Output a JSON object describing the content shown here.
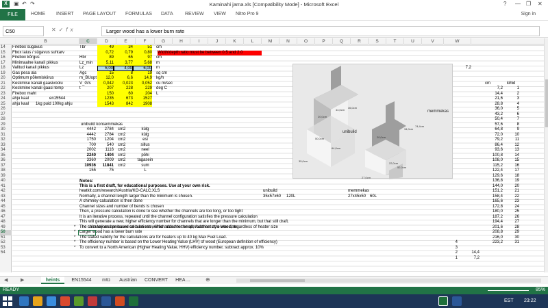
{
  "window": {
    "title": "Kaminahi jama.xls [Compatibility Mode] - Microsoft Excel",
    "help": "?",
    "minimize": "—",
    "restore": "❐",
    "close": "✕"
  },
  "ribbon": {
    "tabs": [
      "FILE",
      "HOME",
      "INSERT",
      "PAGE LAYOUT",
      "FORMULAS",
      "DATA",
      "REVIEW",
      "VIEW",
      "Nitro Pro 9"
    ],
    "sign_in": "Sign in"
  },
  "formula_bar": {
    "name_box": "C50",
    "fx": "fx",
    "content": "Larger wood has a lower burn rate"
  },
  "columns": [
    "B",
    "C",
    "D",
    "E",
    "F",
    "G",
    "H",
    "I",
    "J",
    "K",
    "L",
    "M",
    "N",
    "O",
    "P",
    "Q",
    "R",
    "S",
    "T",
    "U",
    "V",
    "W"
  ],
  "selected_column": "C",
  "rows": [
    "14",
    "15",
    "16",
    "17",
    "18",
    "19",
    "20",
    "21",
    "22",
    "23",
    "24",
    "25",
    "26",
    "27",
    "28",
    "29",
    "30",
    "31",
    "32",
    "33",
    "34",
    "35",
    "36",
    "37",
    "38",
    "39",
    "40",
    "41",
    "42",
    "43",
    "44",
    "45",
    "46",
    "47",
    "48",
    "49",
    "50",
    "51",
    "52",
    "53",
    "54"
  ],
  "selected_row": "50",
  "cells": {
    "a14": "Firebox sügavus",
    "b14": "Tbr",
    "c14": "49",
    "d14": "34",
    "e14": "51",
    "f14": "cm",
    "a15": "Fbox laius / sügavus suhtarv",
    "c15": "0,72",
    "d15": "0,79",
    "e15": "0,80",
    "warn15": "Width/depth ratio must be between 0.5 and 2.0",
    "a16": "Firebox kõrgus",
    "b16": "Hbr",
    "c16": "89",
    "d16": "65",
    "e16": "97",
    "f16": "cm",
    "a17": "Minimaalne kanali pikkus",
    "b17": "Lz_min",
    "c17": "5,11",
    "d17": "3,77",
    "e17": "5,68",
    "f17": "m",
    "a18": "Valitud kanali pikkus",
    "b18": "Lz",
    "c18": "6,00",
    "d18": "4,00",
    "e18": "6,00",
    "f18": "m",
    "a19": "Gas pesa ala",
    "b19": "Agc",
    "c19": "15",
    "d19": "8",
    "e19": "19",
    "f19": "sq cm",
    "a20": "Optimum põlemiskiirus",
    "b20": "m_BUopt",
    "c20": "12,0",
    "d20": "6,6",
    "e20": "14,9",
    "f20": "kg/h",
    "a21": "Keskmise kanali gaasivoolu",
    "b21": "V_G/s",
    "c21": "0,042",
    "d21": "0,023",
    "e21": "0,052",
    "f21": "cu m/sec",
    "a22": "Keskmine kanali gaasi temp",
    "b22": "t",
    "c22": "207",
    "d22": "228",
    "e22": "229",
    "f22": "deg C",
    "a23": "Firebox maht",
    "c23": "150",
    "d23": "60",
    "e23": "204",
    "f23": "L",
    "a24": "ahju kaal",
    "b24": "en15544",
    "c24": "1235",
    "d24": "673",
    "e24": "1527",
    "a25": "ahju kaal",
    "b25": "1kg puid 100kg ahju",
    "c25": "1543",
    "d25": "842",
    "e25": "1908",
    "t18": "7,2",
    "v21": "cm",
    "w21": "kihid",
    "b29": "unibuild konsemmekas",
    "tbl": [
      [
        "4442",
        "2784",
        "cm2",
        "külg"
      ],
      [
        "4442",
        "2784",
        "cm2",
        "külg"
      ],
      [
        "1750",
        "1204",
        "cm2",
        "esi"
      ],
      [
        "700",
        "540",
        "cm2",
        "sillus"
      ],
      [
        "2002",
        "1116",
        "cm2",
        "neel"
      ],
      [
        "2240",
        "1404",
        "cm2",
        "põhi"
      ],
      [
        "3360",
        "2009",
        "cm2",
        "tagasein"
      ],
      [
        "10936",
        "11841",
        "cm2",
        "sum"
      ],
      [
        "155",
        "75",
        "",
        "L"
      ]
    ],
    "notes_title": "Notes:",
    "notes": [
      "This is a first draft, for educational purposes. Use at your own risk.",
      "heatkit.com/research/Austria/KO-CALC.XLS",
      "Normally, a channel length larger than the minimum is chosen.",
      "A chimney calculation is then done",
      "Channel sizes and number of bends is chosen",
      "Then, a pressure calculation is done to see whether the channels are too long, or too tight",
      "It is an iterative process, repeated until the channel configuration satisfies the pressure calculation",
      "This will generate a new, higher efficiency number  for channels that are longer than the minimum, but that still draft.",
      "The chimney and pressure calculations will be added to the spreadsheet at a later date"
    ],
    "unibuild_label": "unibuild",
    "unibuild_size": "35x57x60",
    "unibuild_vol": "120L",
    "memmekas_label": "memmekas",
    "memmekas_size": "27x45x50",
    "memmekas_vol": "60L",
    "bullets": [
      "The calculations are based on burn rate, which assumes small, Austrian style wood, regardless of heater size",
      "Larger wood has a lower burn rate",
      "The stated validity for the calculations are for heaters up to 40 kg Max Fuel Load.",
      "The efficiency number is based on the Lower Heating Value (LHV) of wood (European definition of efficiency)",
      "To convert to a North American (Higher Heating Value, HHV) efficiency number, subtract approx. 10%"
    ],
    "bullet_mark": "*",
    "t_col": [
      "4",
      "3",
      "2",
      "1"
    ],
    "u_col": [
      "14,4",
      "7,2"
    ]
  },
  "layers": {
    "cm": [
      "7,2",
      "14,4",
      "21,6",
      "28,8",
      "36,0",
      "43,2",
      "50,4",
      "57,6",
      "64,8",
      "72,0",
      "79,2",
      "86,4",
      "93,6",
      "100,8",
      "108,0",
      "115,2",
      "122,4",
      "129,6",
      "136,8",
      "144,0",
      "151,2",
      "158,4",
      "165,6",
      "172,8",
      "180,0",
      "187,2",
      "194,4",
      "201,6",
      "208,8",
      "216,0",
      "223,2"
    ],
    "n": [
      "1",
      "2",
      "3",
      "4",
      "5",
      "6",
      "7",
      "8",
      "9",
      "10",
      "11",
      "12",
      "13",
      "14",
      "15",
      "16",
      "17",
      "18",
      "19",
      "20",
      "21",
      "22",
      "23",
      "24",
      "25",
      "26",
      "27",
      "28",
      "29",
      "30",
      "31"
    ]
  },
  "chart": {
    "label_unibuild": "unibuild",
    "label_memmekas": "memmekas",
    "dims": [
      "44,0cm",
      "36,0cm",
      "20,0cm",
      "50,0cm",
      "64,0cm",
      "35,0cm",
      "34,0cm",
      "74,4cm",
      "20,0cm",
      "22,0cm",
      "52,0cm",
      "27,0cm"
    ]
  },
  "sheet_tabs": [
    "heints",
    "EN15544",
    "mtü",
    "Austrian",
    "CONVERT",
    "HEA ..."
  ],
  "active_sheet": "heints",
  "status": {
    "ready": "READY",
    "zoom": "85%"
  },
  "taskbar": {
    "lang": "EST",
    "time": "23:22"
  }
}
